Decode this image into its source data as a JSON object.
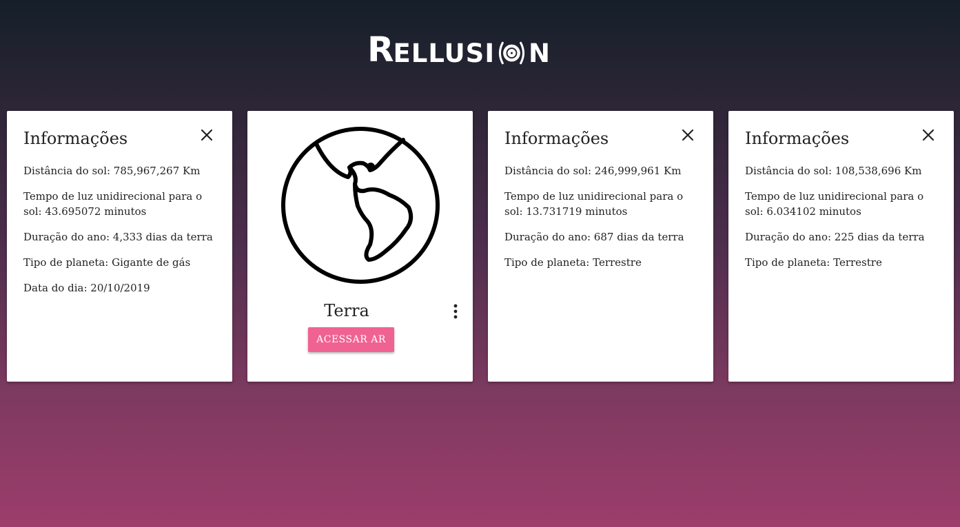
{
  "logo": {
    "big_letter": "R",
    "text_before": "ELLUSI",
    "text_after": "N"
  },
  "info_cards": [
    {
      "title": "Informações",
      "lines": [
        "Distância do sol: 785,967,267 Km",
        "Tempo de luz unidirecional para o sol: 43.695072 minutos",
        "Duração do ano: 4,333 dias da terra",
        "Tipo de planeta: Gigante de gás",
        "Data do dia: 20/10/2019"
      ]
    },
    {
      "title": "Informações",
      "lines": [
        "Distância do sol: 246,999,961 Km",
        "Tempo de luz unidirecional para o sol: 13.731719 minutos",
        "Duração do ano: 687 dias da terra",
        "Tipo de planeta: Terrestre"
      ]
    },
    {
      "title": "Informações",
      "lines": [
        "Distância do sol: 108,538,696 Km",
        "Tempo de luz unidirecional para o sol: 6.034102 minutos",
        "Duração do ano: 225 dias da terra",
        "Tipo de planeta: Terrestre"
      ]
    }
  ],
  "planet_card": {
    "name": "Terra",
    "button_label": "ACESSAR AR",
    "icon": "globe-americas-icon"
  },
  "colors": {
    "accent": "#f06292",
    "card_bg": "#ffffff",
    "bg_top": "#151f29",
    "bg_bottom": "#9d3d6c"
  }
}
